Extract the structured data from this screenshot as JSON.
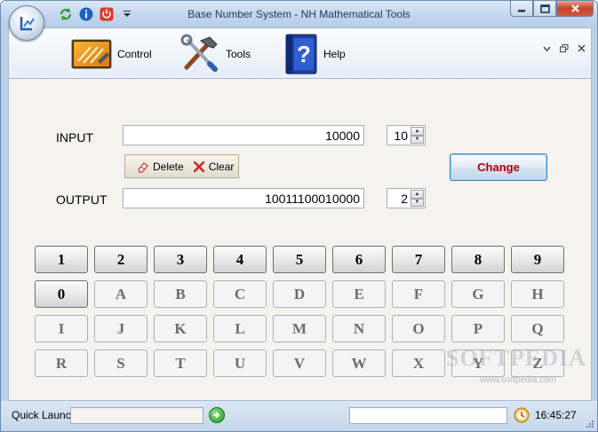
{
  "window": {
    "title": "Base Number System - NH Mathematical Tools"
  },
  "ribbon": {
    "items": [
      {
        "label": "Control",
        "icon": "control-panel-icon"
      },
      {
        "label": "Tools",
        "icon": "tools-icon"
      },
      {
        "label": "Help",
        "icon": "help-book-icon"
      }
    ]
  },
  "form": {
    "input_label": "INPUT",
    "input_value": "10000",
    "input_base": "10",
    "output_label": "OUTPUT",
    "output_value": "10011100010000",
    "output_base": "2",
    "delete_label": "Delete",
    "clear_label": "Clear",
    "change_label": "Change"
  },
  "keypad": {
    "keys": [
      "1",
      "2",
      "3",
      "4",
      "5",
      "6",
      "7",
      "8",
      "9",
      "0",
      "A",
      "B",
      "C",
      "D",
      "E",
      "F",
      "G",
      "H",
      "I",
      "J",
      "K",
      "L",
      "M",
      "N",
      "O",
      "P",
      "Q",
      "R",
      "S",
      "T",
      "U",
      "V",
      "W",
      "X",
      "Y",
      "Z"
    ],
    "enabled_count": 10
  },
  "watermark": {
    "text": "SOFTPEDIA",
    "sub": "www.softpedia.com"
  },
  "statusbar": {
    "quick_launch_label": "Quick Launch",
    "clock": "16:45:27"
  },
  "colors": {
    "change_text": "#b00000",
    "window_frame": "#bcd0e6"
  }
}
